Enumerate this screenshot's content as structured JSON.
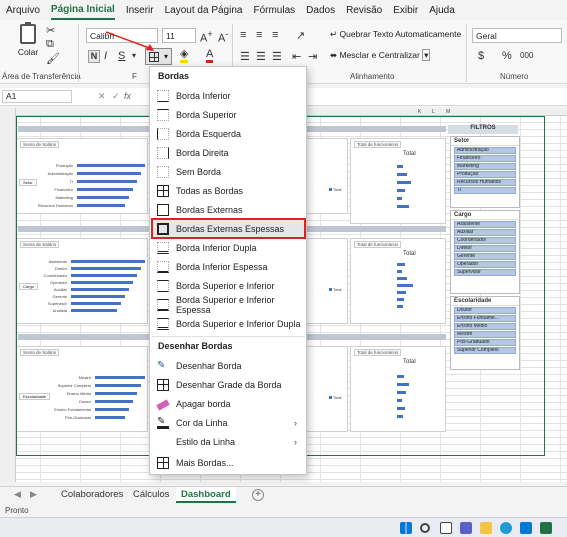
{
  "menubar": {
    "tabs": [
      "Arquivo",
      "Página Inicial",
      "Inserir",
      "Layout da Página",
      "Fórmulas",
      "Dados",
      "Revisão",
      "Exibir",
      "Ajuda"
    ],
    "active_index": 1
  },
  "ribbon": {
    "paste_label": "Colar",
    "clipboard_group": "Área de Transferência",
    "font_group_short": "F",
    "font_name": "Calibri",
    "font_size": "11",
    "wrap_text": "Quebrar Texto Automaticamente",
    "merge_center": "Mesclar e Centralizar",
    "alignment_group": "Alinhamento",
    "number_format": "Geral",
    "number_group": "Número",
    "currency_symbol": "$",
    "percent_symbol": "%",
    "thousands_symbol": "000"
  },
  "formula_bar": {
    "name_box": "A1",
    "fx": "fx"
  },
  "dropdown": {
    "section_borders": "Bordas",
    "items": [
      "Borda Inferior",
      "Borda Superior",
      "Borda Esquerda",
      "Borda Direita",
      "Sem Borda",
      "Todas as Bordas",
      "Bordas Externas",
      "Bordas Externas Espessas",
      "Borda Inferior Dupla",
      "Borda Inferior Espessa",
      "Borda Superior e Inferior",
      "Borda Superior e Inferior Espessa",
      "Borda Superior e Inferior Dupla"
    ],
    "highlighted_index": 7,
    "section_draw": "Desenhar Bordas",
    "draw_items": [
      "Desenhar Borda",
      "Desenhar Grade da Borda",
      "Apagar borda",
      "Cor da Linha",
      "Estilo da Linha"
    ],
    "more_borders": "Mais Bordas..."
  },
  "dashboard": {
    "filters_title": "FILTROS",
    "total_label": "Total",
    "slicers": [
      {
        "title": "Setor",
        "items": [
          "Administração",
          "Financeiro",
          "Marketing",
          "Produção",
          "Recursos Humanos",
          "TI"
        ]
      },
      {
        "title": "Cargo",
        "items": [
          "Assistente",
          "Auxiliar",
          "Coordenador",
          "Diretor",
          "Gerente",
          "Operador",
          "Supervisor"
        ]
      },
      {
        "title": "Escolaridade",
        "items": [
          "Doutor",
          "Ensino Fundame...",
          "Ensino Médio",
          "Mestre",
          "Pós-Graduado",
          "Superior Completo"
        ]
      }
    ],
    "panel_salary": "Soma de Salário",
    "panel_count": "Total de funcionários",
    "field_setor": "Setor",
    "field_cargo": "Cargo",
    "field_escolaridade": "Escolaridade",
    "chart1_labels": [
      "Produção",
      "Administração",
      "TI",
      "Financeiro",
      "Marketing",
      "Recursos Humanos"
    ],
    "chart2_labels": [
      "Assistente",
      "Diretor",
      "Coordenador",
      "Operador",
      "Auxiliar",
      "Gerente",
      "Supervisor",
      "Analista"
    ],
    "chart3_labels": [
      "Mestre",
      "Superior Completo",
      "Ensino Médio",
      "Doutor",
      "Ensino Fundamental",
      "Pós-Graduado"
    ]
  },
  "sheet_tabs": [
    "Colaboradores",
    "Cálculos",
    "Dashboard"
  ],
  "active_sheet_index": 2,
  "status": "Pronto"
}
